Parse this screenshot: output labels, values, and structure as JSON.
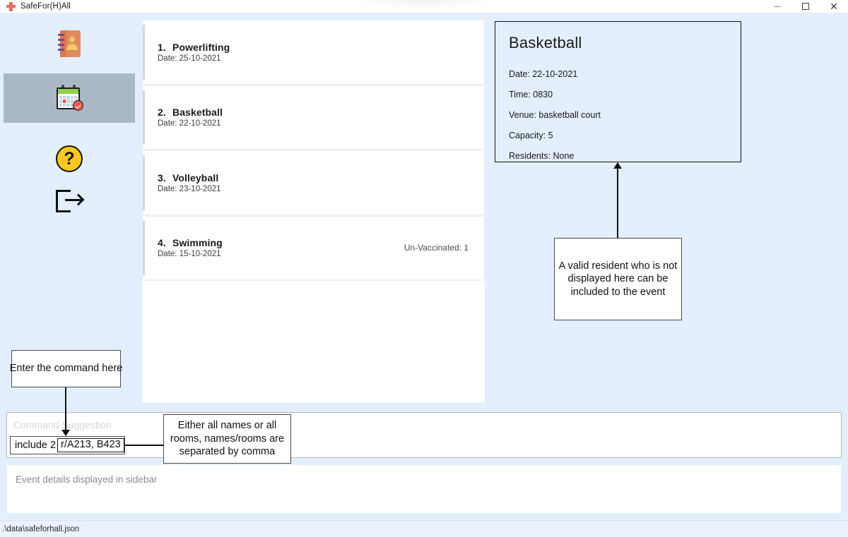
{
  "window": {
    "title": "SafeFor(H)All",
    "app_icon": "red-cross-icon",
    "controls": {
      "minimize": "minimize-icon",
      "maximize": "maximize-icon",
      "close": "close-icon"
    }
  },
  "sidebar": {
    "items": [
      {
        "name": "contacts",
        "icon": "address-book-icon",
        "selected": false
      },
      {
        "name": "events",
        "icon": "calendar-check-icon",
        "selected": true
      },
      {
        "name": "help",
        "icon": "question-mark-icon",
        "selected": false
      },
      {
        "name": "exit",
        "icon": "logout-icon",
        "selected": false
      }
    ]
  },
  "event_list": {
    "events": [
      {
        "index": "1.",
        "title": "Powerlifting",
        "date": "Date: 25-10-2021",
        "tag": ""
      },
      {
        "index": "2.",
        "title": "Basketball",
        "date": "Date: 22-10-2021",
        "tag": ""
      },
      {
        "index": "3.",
        "title": "Volleyball",
        "date": "Date: 23-10-2021",
        "tag": ""
      },
      {
        "index": "4.",
        "title": "Swimming",
        "date": "Date: 15-10-2021",
        "tag": "Un-Vaccinated: 1"
      }
    ]
  },
  "details_panel": {
    "title": "Basketball",
    "date": "Date: 22-10-2021",
    "time": "Time: 0830",
    "venue": "Venue: basketball court",
    "capacity": "Capacity: 5",
    "residents": "Residents: None"
  },
  "command": {
    "placeholder": "Command Suggestion",
    "entered_prefix": "include 2 ",
    "entered_arg": "r/A213, B423"
  },
  "result": {
    "message": "Event details displayed in sidebar"
  },
  "status_bar": {
    "file_path": ".\\data\\safeforhall.json"
  },
  "annotations": {
    "resident": "A valid resident who is not displayed here can be included to the event",
    "command": "Enter the command here",
    "comma": "Either all names or all rooms, names/rooms are separated by comma"
  },
  "colors": {
    "app_background": "#e3effc",
    "selected_nav": "#aab8c6",
    "panel_white": "#ffffff",
    "accent_red": "#ee6a5f",
    "help_yellow": "#ffc81f",
    "book_orange": "#e08a5d"
  }
}
